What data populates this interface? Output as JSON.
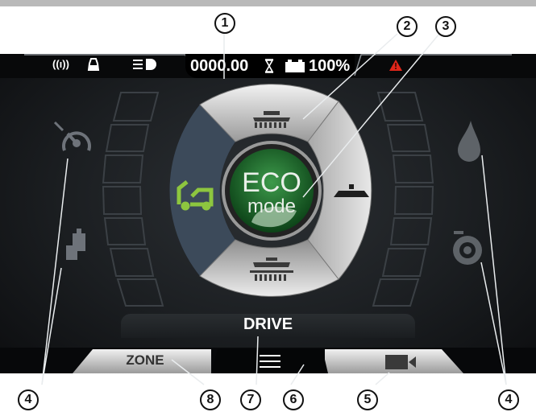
{
  "top_status": {
    "counter": "0000.00",
    "battery": "100%",
    "icons": [
      "wifi-icon",
      "tank-level-icon",
      "headlight-icon",
      "hourglass-icon",
      "battery-icon",
      "warning-triangle-icon"
    ]
  },
  "center_dial": {
    "mode_line1": "ECO",
    "mode_line2": "mode",
    "icons": [
      "brush-up-icon",
      "brush-side-icon",
      "brush-down-icon",
      "machine-icon",
      "leaf-icon"
    ]
  },
  "side_indicators": {
    "left_icons": [
      "speed-gauge-icon",
      "weight-icon"
    ],
    "right_icons": [
      "water-drop-icon",
      "brush-pressure-icon"
    ],
    "left_level": 0,
    "right_level": 0
  },
  "drive_label": "DRIVE",
  "bottom_nav": {
    "zone_label": "ZONE",
    "menu_icon": "menu-icon",
    "camera_icon": "camera-icon"
  },
  "callouts": {
    "c1": "1",
    "c2": "2",
    "c3": "3",
    "c4a": "4",
    "c4b": "4",
    "c5": "5",
    "c6": "6",
    "c7": "7",
    "c8": "8"
  },
  "colors": {
    "accent_green": "#8dc63f",
    "eco_green": "#1d6a2a",
    "warning_red": "#e0261a",
    "screen_bg": "#1b1e21"
  }
}
